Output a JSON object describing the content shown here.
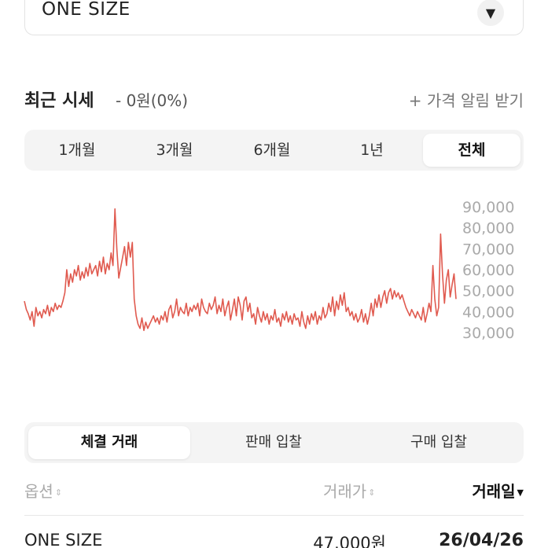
{
  "size_select": {
    "value": "ONE SIZE",
    "icon": "chevron-down-icon"
  },
  "price_header": {
    "title": "최근 시세",
    "change": "- 0원(0%)",
    "alert": "+ 가격 알림 받기"
  },
  "period_tabs": [
    {
      "label": "1개월",
      "active": false
    },
    {
      "label": "3개월",
      "active": false
    },
    {
      "label": "6개월",
      "active": false
    },
    {
      "label": "1년",
      "active": false
    },
    {
      "label": "전체",
      "active": true
    }
  ],
  "chart_data": {
    "type": "line",
    "series": [
      {
        "color": "#e05a4f",
        "values": [
          45000,
          41000,
          39000,
          36000,
          40000,
          33000,
          42000,
          38000,
          40000,
          37000,
          41000,
          39000,
          43000,
          38000,
          42000,
          40000,
          44000,
          41000,
          43000,
          42000,
          45000,
          49000,
          60000,
          52000,
          58000,
          54000,
          60000,
          57000,
          62000,
          55000,
          59000,
          56000,
          61000,
          57000,
          63000,
          58000,
          60000,
          62000,
          57000,
          64000,
          59000,
          66000,
          58000,
          63000,
          60000,
          68000,
          62000,
          89000,
          70000,
          56000,
          61000,
          66000,
          71000,
          62000,
          73000,
          66000,
          73000,
          46000,
          38000,
          34000,
          32000,
          37000,
          31000,
          35000,
          32000,
          34000,
          36000,
          38000,
          35000,
          37000,
          34000,
          38000,
          36000,
          40000,
          35000,
          41000,
          43000,
          37000,
          40000,
          46000,
          38000,
          42000,
          40000,
          39000,
          44000,
          38000,
          42000,
          40000,
          43000,
          41000,
          44000,
          38000,
          46000,
          42000,
          40000,
          39000,
          44000,
          41000,
          43000,
          47000,
          39000,
          43000,
          40000,
          46000,
          38000,
          42000,
          45000,
          36000,
          41000,
          46000,
          38000,
          47000,
          43000,
          36000,
          45000,
          47000,
          40000,
          44000,
          37000,
          39000,
          34000,
          42000,
          38000,
          35000,
          40000,
          36000,
          39000,
          34000,
          38000,
          36000,
          41000,
          35000,
          37000,
          33000,
          39000,
          36000,
          40000,
          35000,
          38000,
          34000,
          39000,
          36000,
          37000,
          33000,
          40000,
          35000,
          32000,
          38000,
          34000,
          39000,
          36000,
          40000,
          34000,
          38000,
          36000,
          42000,
          37000,
          39000,
          44000,
          40000,
          47000,
          38000,
          45000,
          41000,
          48000,
          43000,
          49000,
          40000,
          42000,
          38000,
          40000,
          36000,
          39000,
          35000,
          37000,
          41000,
          35000,
          39000,
          34000,
          38000,
          44000,
          38000,
          46000,
          42000,
          48000,
          42000,
          47000,
          50000,
          44000,
          49000,
          51000,
          46000,
          50000,
          47000,
          49000,
          46000,
          48000,
          45000,
          42000,
          40000,
          38000,
          41000,
          39000,
          37000,
          40000,
          38000,
          36000,
          42000,
          35000,
          39000,
          44000,
          40000,
          62000,
          46000,
          38000,
          42000,
          77000,
          58000,
          44000,
          55000,
          60000,
          47000,
          53000,
          58000,
          46000
        ]
      }
    ],
    "y_ticks": [
      "90,000",
      "80,000",
      "70,000",
      "60,000",
      "50,000",
      "40,000",
      "30,000"
    ],
    "ylim": [
      30000,
      90000
    ],
    "grid": false
  },
  "trade_tabs": [
    {
      "label": "체결 거래",
      "active": true
    },
    {
      "label": "판매 입찰",
      "active": false
    },
    {
      "label": "구매 입찰",
      "active": false
    }
  ],
  "table": {
    "headers": {
      "option": "옵션",
      "price": "거래가",
      "date": "거래일"
    },
    "rows": [
      {
        "option": "ONE SIZE",
        "price": "47,000원",
        "date": "26/04/26"
      }
    ]
  }
}
